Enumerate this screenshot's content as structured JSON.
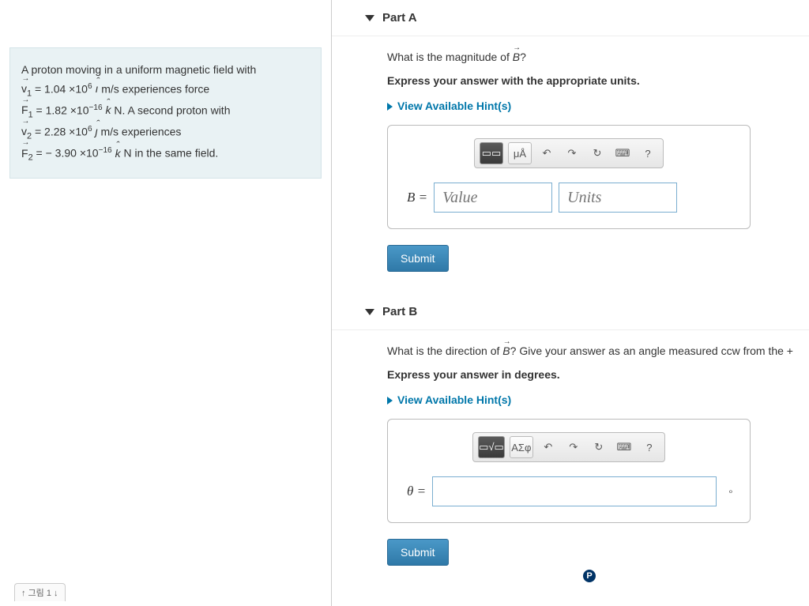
{
  "problem": {
    "intro_a": "A proton moving in a uniform magnetic field with",
    "v1_label": "v",
    "v1_sub": "1",
    "eq": " = ",
    "v1_val": "1.04 ×10",
    "v1_exp": "6",
    "v1_unit_pre": " ",
    "ihat": "ı",
    "mps": " m/s",
    "intro_b": " experiences force",
    "F1_label": "F",
    "F1_sub": "1",
    "F1_val": "1.82 ×10",
    "F1_exp": "−16",
    "khat": "k",
    "newton": " N",
    "intro_c": ". A second proton with",
    "v2_label": "v",
    "v2_sub": "2",
    "v2_val": "2.28 ×10",
    "v2_exp": "6",
    "jhat": "ȷ",
    "intro_d": " experiences",
    "F2_label": "F",
    "F2_sub": "2",
    "F2_val": "− 3.90 ×10",
    "F2_exp": "−16",
    "intro_e": " in the same field."
  },
  "partA": {
    "title": "Part A",
    "q_pre": "What is the magnitude of ",
    "q_vec": "B",
    "q_post": "?",
    "instruction": "Express your answer with the appropriate units.",
    "hints": "View Available Hint(s)",
    "toolbar": {
      "templates_icon": "▭▭",
      "units_btn": "μÅ",
      "undo_icon": "↶",
      "redo_icon": "↷",
      "reset_icon": "↻",
      "keyboard_icon": "⌨",
      "help_icon": "?"
    },
    "var": "B",
    "equals": " = ",
    "value_placeholder": "Value",
    "units_placeholder": "Units",
    "submit": "Submit"
  },
  "partB": {
    "title": "Part B",
    "q_pre": "What is the direction of ",
    "q_vec": "B",
    "q_post": "? Give your answer as an angle measured ccw from the +",
    "instruction": "Express your answer in degrees.",
    "hints": "View Available Hint(s)",
    "toolbar": {
      "templates_icon": "▭√▭",
      "symbols_btn": "ΑΣφ",
      "undo_icon": "↶",
      "redo_icon": "↷",
      "reset_icon": "↻",
      "keyboard_icon": "⌨",
      "help_icon": "?"
    },
    "var": "θ",
    "equals": " = ",
    "unit_suffix": "∘",
    "submit": "Submit"
  },
  "footer": {
    "bottom_stub": "↑ 그림 1 ↓",
    "brand_partial": "P"
  }
}
